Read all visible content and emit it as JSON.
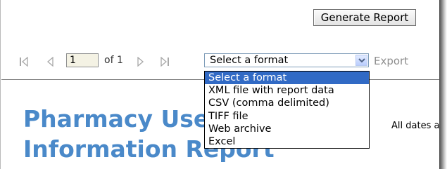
{
  "toolbar": {
    "generate_label": "Generate Report",
    "page_value": "1",
    "of_label": "of 1",
    "export_label": "Export",
    "first_icon": "first-page-icon",
    "prev_icon": "previous-page-icon",
    "next_icon": "next-page-icon",
    "last_icon": "last-page-icon"
  },
  "format_select": {
    "selected": "Select a format",
    "options": [
      "Select a format",
      "XML file with report data",
      "CSV (comma delimited)",
      "TIFF file",
      "Web archive",
      "Excel"
    ]
  },
  "report": {
    "title": "Pharmacy Use\nInformation Report",
    "dates_note": "All dates a"
  },
  "colors": {
    "title": "#4a89c9",
    "selected_option": "#316ac5",
    "disabled_text": "#8f8f8f"
  }
}
